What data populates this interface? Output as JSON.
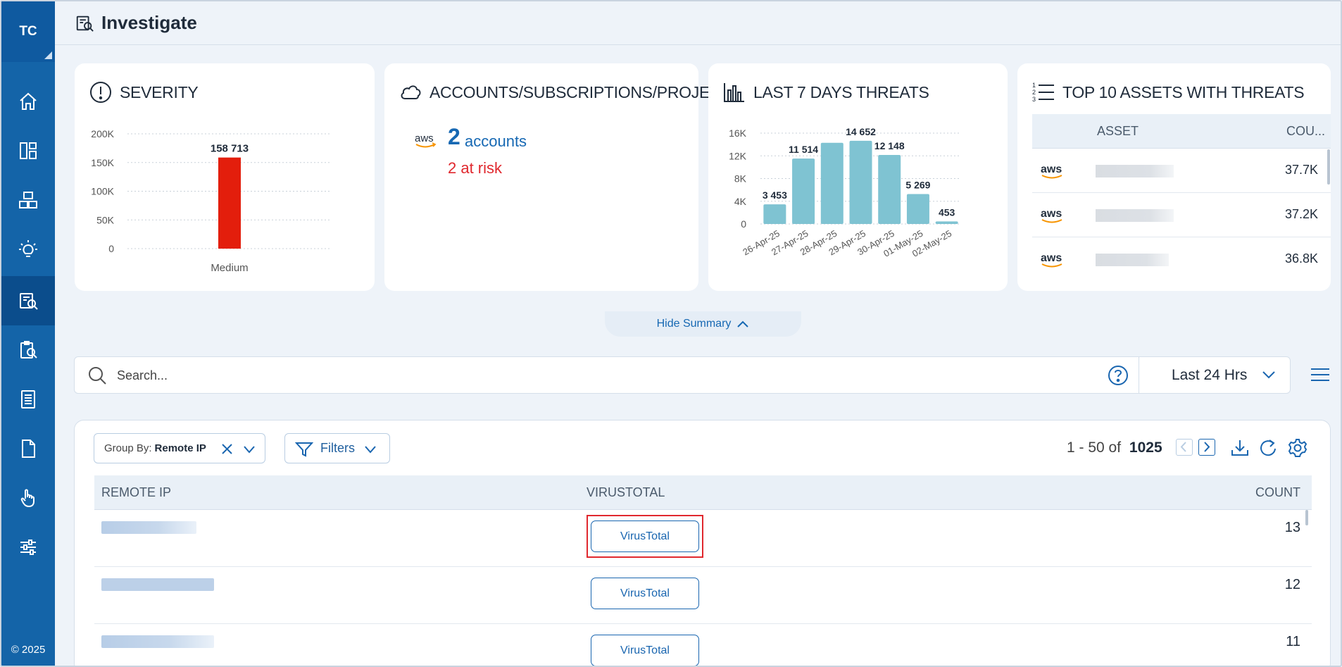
{
  "sidebar": {
    "avatar": "TC",
    "items": [
      "home-icon",
      "dashboard-icon",
      "inventory-icon",
      "insights-icon",
      "investigate-icon",
      "compliance-icon",
      "reports-icon",
      "document-icon",
      "hand-icon",
      "settings-icon"
    ],
    "active": "investigate-icon",
    "copyright": "© 2025"
  },
  "header": {
    "title": "Investigate"
  },
  "summary": {
    "severity": {
      "title": "SEVERITY",
      "chart_data": {
        "type": "bar",
        "categories": [
          "Medium"
        ],
        "values": [
          158713
        ],
        "value_labels": [
          "158 713"
        ],
        "yticks": [
          "0",
          "50K",
          "100K",
          "150K",
          "200K"
        ],
        "ylim": [
          0,
          200000
        ],
        "color": "#e31e0c"
      }
    },
    "accounts": {
      "title": "ACCOUNTS/SUBSCRIPTIONS/PROJECTS",
      "provider_icon": "aws-logo",
      "count": "2",
      "count_label": "accounts",
      "risk": "2 at risk"
    },
    "threats": {
      "title": "LAST 7 DAYS THREATS",
      "chart_data": {
        "type": "bar",
        "categories": [
          "26-Apr-25",
          "27-Apr-25",
          "28-Apr-25",
          "29-Apr-25",
          "30-Apr-25",
          "01-May-25",
          "02-May-25"
        ],
        "values": [
          3453,
          11514,
          14300,
          14652,
          12148,
          5269,
          453
        ],
        "value_labels": [
          "3 453",
          "11 514",
          "",
          "14 652",
          "12 148",
          "5 269",
          "453"
        ],
        "yticks": [
          "0",
          "4K",
          "8K",
          "12K",
          "16K"
        ],
        "ylim": [
          0,
          16000
        ],
        "color": "#7fc3d2"
      }
    },
    "top_assets": {
      "title": "TOP 10 ASSETS WITH THREATS",
      "columns": [
        "ASSET",
        "COU..."
      ],
      "rows": [
        {
          "icon": "aws-logo",
          "count": "37.7K"
        },
        {
          "icon": "aws-logo",
          "count": "37.2K"
        },
        {
          "icon": "aws-logo",
          "count": "36.8K"
        }
      ]
    },
    "hide_label": "Hide Summary"
  },
  "search": {
    "placeholder": "Search...",
    "time_range": "Last 24 Hrs"
  },
  "toolbar": {
    "group_by_label": "Group By:",
    "group_by_value": "Remote IP",
    "filters_label": "Filters",
    "range_text": "1 - 50 of",
    "total": "1025"
  },
  "table": {
    "columns": [
      "REMOTE IP",
      "VIRUSTOTAL",
      "COUNT"
    ],
    "rows": [
      {
        "virustotal": "VirusTotal",
        "count": "13"
      },
      {
        "virustotal": "VirusTotal",
        "count": "12"
      },
      {
        "virustotal": "VirusTotal",
        "count": "11"
      }
    ]
  }
}
